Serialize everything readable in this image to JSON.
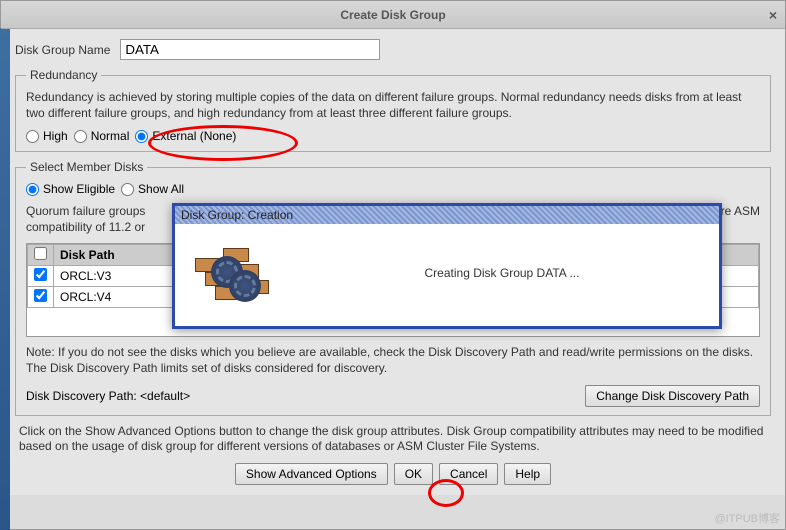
{
  "window": {
    "title": "Create Disk Group"
  },
  "form": {
    "disk_group_name_label": "Disk Group Name",
    "disk_group_name_value": "DATA"
  },
  "redundancy": {
    "legend": "Redundancy",
    "desc": "Redundancy is achieved by storing multiple copies of the data on different failure groups. Normal redundancy needs disks from at least two different failure groups, and high redundancy from at least three different failure groups.",
    "options": {
      "high": "High",
      "normal": "Normal",
      "external": "External (None)"
    },
    "selected": "external"
  },
  "member": {
    "legend": "Select Member Disks",
    "show_eligible": "Show Eligible",
    "show_all": "Show All",
    "selected": "eligible",
    "quorum_text": "Quorum failure groups",
    "quorum_text2": "compatibility of 11.2 or",
    "quorum_tail": "uire ASM",
    "table": {
      "header": "Disk Path",
      "rows": [
        {
          "checked": true,
          "path": "ORCL:V3"
        },
        {
          "checked": true,
          "path": "ORCL:V4"
        }
      ]
    },
    "note": "Note: If you do not see the disks which you believe are available, check the Disk Discovery Path and read/write permissions on the disks. The Disk Discovery Path limits set of disks considered for discovery.",
    "path_label": "Disk Discovery Path: <default>",
    "change_btn": "Change Disk Discovery Path"
  },
  "bottom": {
    "text": "Click on the Show Advanced Options button to change the disk group attributes. Disk Group compatibility attributes may need to be modified based on the usage of disk group for different versions of databases or ASM Cluster File Systems.",
    "adv": "Show Advanced Options",
    "ok": "OK",
    "cancel": "Cancel",
    "help": "Help"
  },
  "modal": {
    "title": "Disk Group: Creation",
    "text": "Creating Disk Group DATA ..."
  },
  "watermark": "@ITPUB博客"
}
